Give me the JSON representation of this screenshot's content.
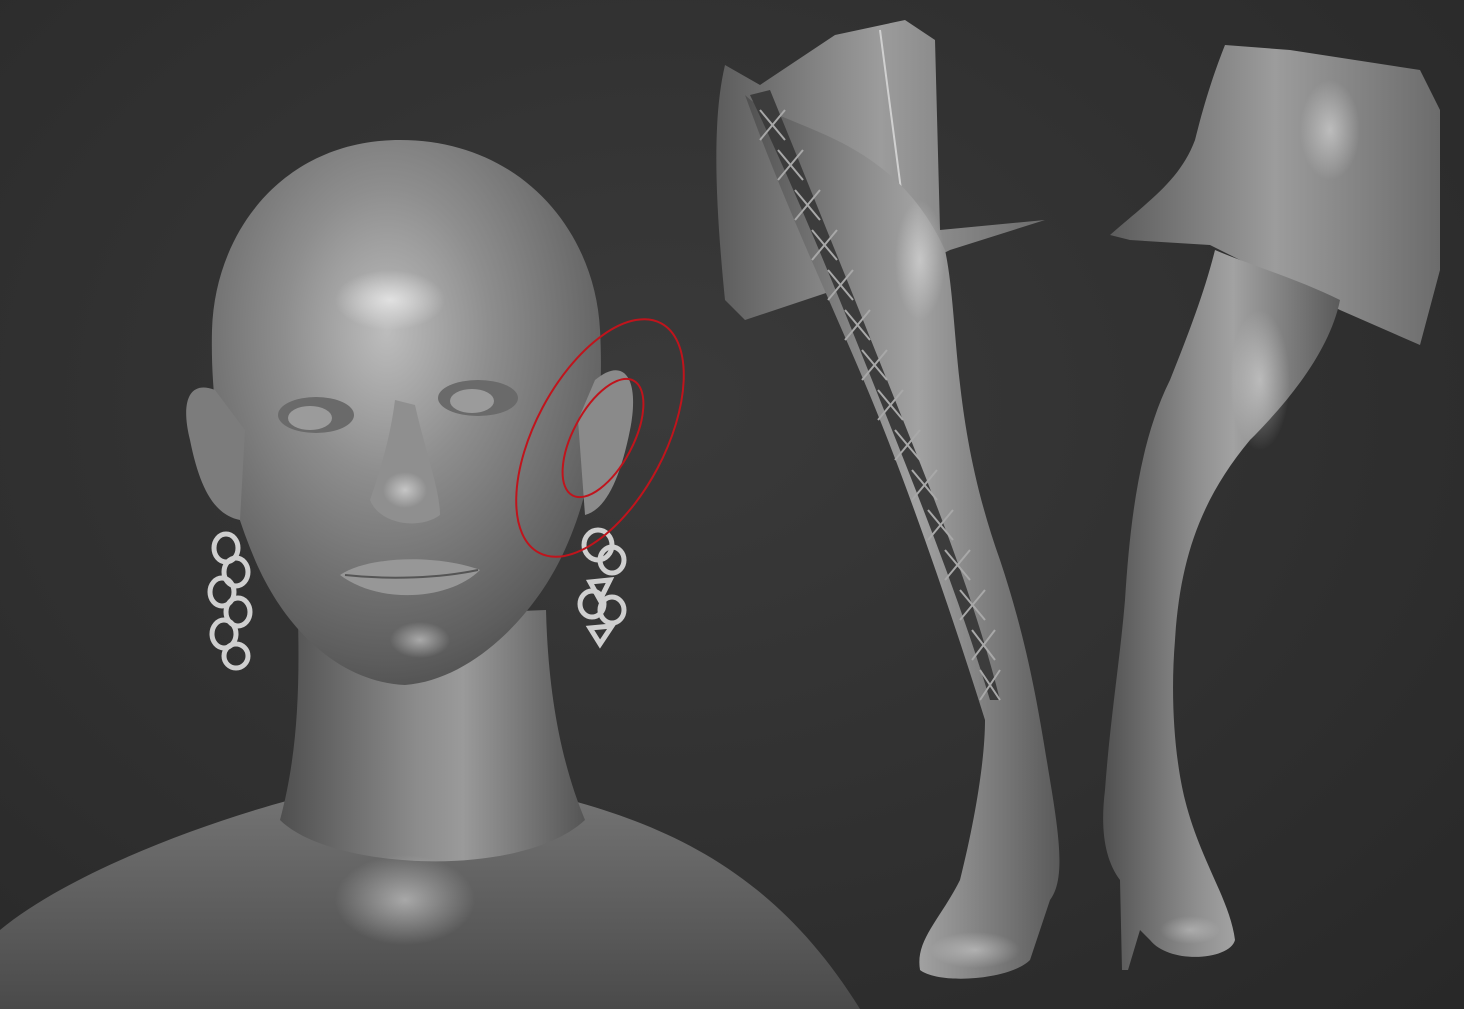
{
  "viewport": {
    "background": "#2e2e2e",
    "material_color": "#8a8a8a",
    "highlight_color": "#d8d8d8",
    "annotation_color": "#c0141c"
  },
  "models": [
    {
      "name": "female-head-bust",
      "icon": "bust-sculpt"
    },
    {
      "name": "chain-earrings",
      "icon": "chainmail-rings"
    },
    {
      "name": "laced-thigh-boot-and-skirt-front",
      "icon": "boot-sculpt"
    },
    {
      "name": "thigh-boot-and-skirt-back",
      "icon": "boot-sculpt"
    }
  ],
  "annotation": {
    "shape": "ellipse",
    "target": "ear",
    "rings": 2
  }
}
